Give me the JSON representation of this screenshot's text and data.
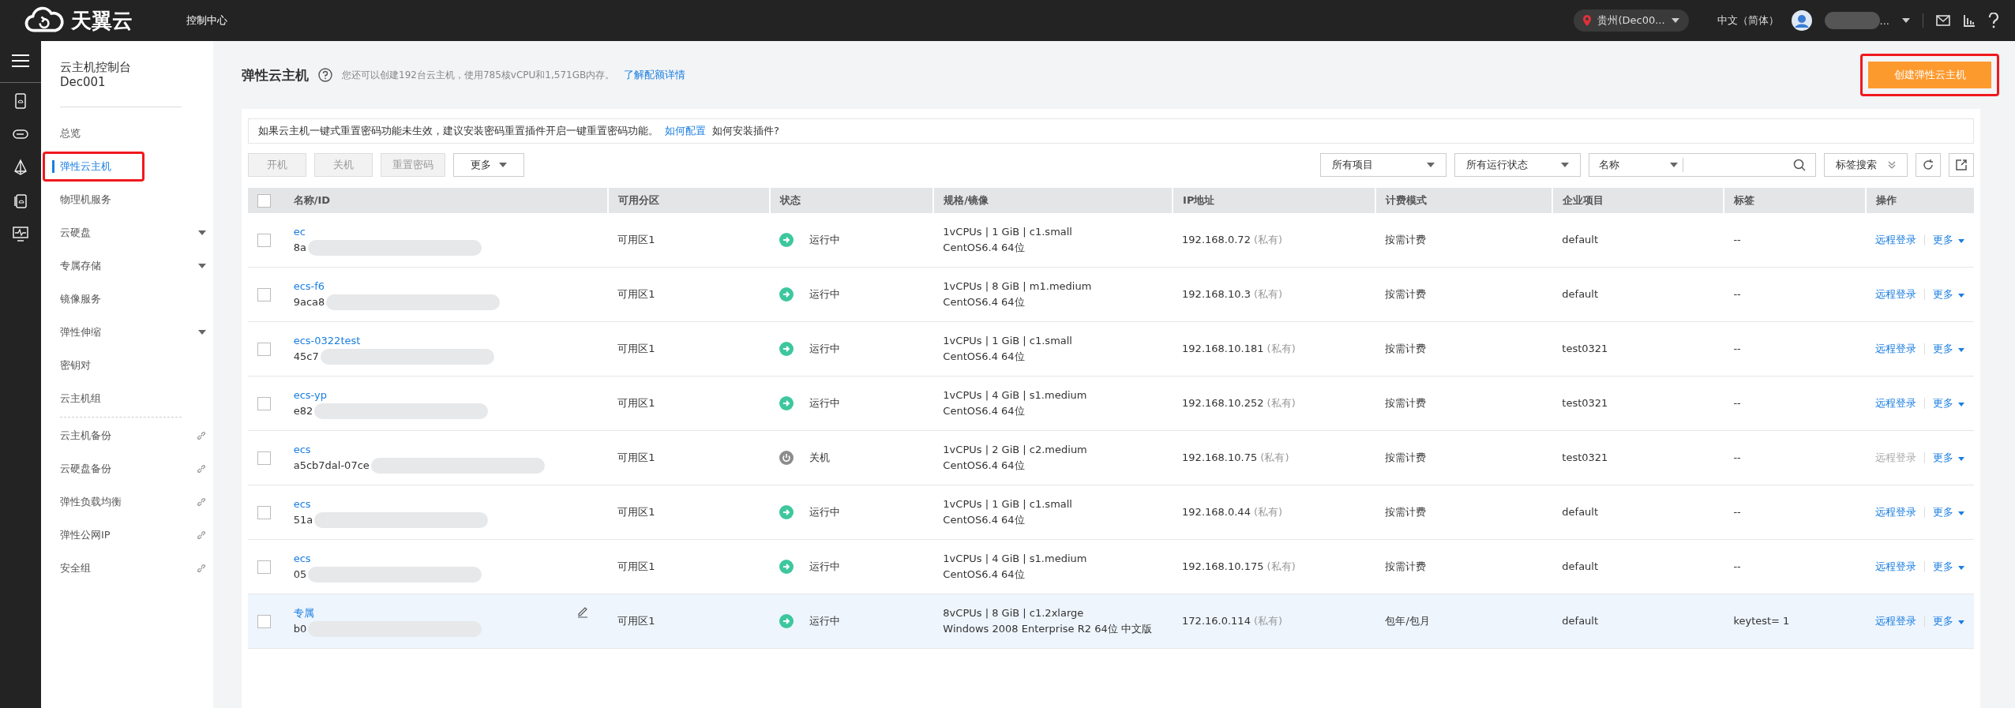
{
  "top_bar": {
    "brand": "天翼云",
    "console": "控制中心",
    "region": "贵州(Dec00...",
    "language": "中文（简体）",
    "user_name": "..."
  },
  "sidebar": {
    "title": "云主机控制台",
    "subtitle": "Dec001",
    "groups": [
      [
        {
          "label": "总览",
          "selected": false,
          "annotated": false,
          "kind": "plain"
        },
        {
          "label": "弹性云主机",
          "selected": true,
          "annotated": true,
          "kind": "plain"
        },
        {
          "label": "物理机服务",
          "selected": false,
          "annotated": false,
          "kind": "plain"
        },
        {
          "label": "云硬盘",
          "selected": false,
          "annotated": false,
          "kind": "menu"
        },
        {
          "label": "专属存储",
          "selected": false,
          "annotated": false,
          "kind": "menu"
        },
        {
          "label": "镜像服务",
          "selected": false,
          "annotated": false,
          "kind": "plain"
        },
        {
          "label": "弹性伸缩",
          "selected": false,
          "annotated": false,
          "kind": "menu"
        },
        {
          "label": "密钥对",
          "selected": false,
          "annotated": false,
          "kind": "plain"
        },
        {
          "label": "云主机组",
          "selected": false,
          "annotated": false,
          "kind": "plain"
        }
      ],
      [
        {
          "label": "云主机备份",
          "selected": false,
          "annotated": false,
          "kind": "link"
        },
        {
          "label": "云硬盘备份",
          "selected": false,
          "annotated": false,
          "kind": "link"
        },
        {
          "label": "弹性负载均衡",
          "selected": false,
          "annotated": false,
          "kind": "link"
        },
        {
          "label": "弹性公网IP",
          "selected": false,
          "annotated": false,
          "kind": "link"
        },
        {
          "label": "安全组",
          "selected": false,
          "annotated": false,
          "kind": "link"
        }
      ]
    ]
  },
  "header": {
    "title": "弹性云主机",
    "quota_text": "您还可以创建192台云主机，使用785核vCPU和1,571GB内存。",
    "quota_link": "了解配额详情",
    "create_button": {
      "label": "创建弹性云主机",
      "annotated": true
    }
  },
  "notice": {
    "text": "如果云主机一键式重置密码功能未生效，建议安装密码重置插件开启一键重置密码功能。",
    "link": "如何配置",
    "question": "如何安装插件?"
  },
  "toolbar": {
    "buttons": [
      {
        "label": "开机",
        "disabled": true
      },
      {
        "label": "关机",
        "disabled": true
      },
      {
        "label": "重置密码",
        "disabled": true
      }
    ],
    "more": "更多",
    "filters": [
      "所有项目",
      "所有运行状态"
    ],
    "search_field": "名称",
    "tag_search": "标签搜索"
  },
  "table": {
    "all_checked": false,
    "columns": [
      "名称/ID",
      "可用分区",
      "状态",
      "规格/镜像",
      "IP地址",
      "计费模式",
      "企业项目",
      "标签",
      "操作"
    ],
    "rows": [
      {
        "name": "ec",
        "id": "8a",
        "zone": "可用区1",
        "status": {
          "kind": "running",
          "label": "运行中"
        },
        "spec": "1vCPUs | 1 GiB | c1.small",
        "image": "CentOS6.4 64位",
        "ip": "192.168.0.72",
        "ip_type": "(私有)",
        "billing": "按需计费",
        "project": "default",
        "tag": "--",
        "login": "远程登录",
        "login_disabled": false,
        "more": "更多",
        "highlighted": false,
        "editable": false,
        "checked": false
      },
      {
        "name": "ecs-f6",
        "id": "9aca8",
        "zone": "可用区1",
        "status": {
          "kind": "running",
          "label": "运行中"
        },
        "spec": "1vCPUs | 8 GiB | m1.medium",
        "image": "CentOS6.4 64位",
        "ip": "192.168.10.3",
        "ip_type": "(私有)",
        "billing": "按需计费",
        "project": "default",
        "tag": "--",
        "login": "远程登录",
        "login_disabled": false,
        "more": "更多",
        "highlighted": false,
        "editable": false,
        "checked": false
      },
      {
        "name": "ecs-0322test",
        "id": "45c7",
        "zone": "可用区1",
        "status": {
          "kind": "running",
          "label": "运行中"
        },
        "spec": "1vCPUs | 1 GiB | c1.small",
        "image": "CentOS6.4 64位",
        "ip": "192.168.10.181",
        "ip_type": "(私有)",
        "billing": "按需计费",
        "project": "test0321",
        "tag": "--",
        "login": "远程登录",
        "login_disabled": false,
        "more": "更多",
        "highlighted": false,
        "editable": false,
        "checked": false
      },
      {
        "name": "ecs-yp",
        "id": "e82",
        "zone": "可用区1",
        "status": {
          "kind": "running",
          "label": "运行中"
        },
        "spec": "1vCPUs | 4 GiB | s1.medium",
        "image": "CentOS6.4 64位",
        "ip": "192.168.10.252",
        "ip_type": "(私有)",
        "billing": "按需计费",
        "project": "test0321",
        "tag": "--",
        "login": "远程登录",
        "login_disabled": false,
        "more": "更多",
        "highlighted": false,
        "editable": false,
        "checked": false
      },
      {
        "name": "ecs",
        "id": "a5cb7dal-07ce",
        "zone": "可用区1",
        "status": {
          "kind": "stopped",
          "label": "关机"
        },
        "spec": "1vCPUs | 2 GiB | c2.medium",
        "image": "CentOS6.4 64位",
        "ip": "192.168.10.75",
        "ip_type": "(私有)",
        "billing": "按需计费",
        "project": "test0321",
        "tag": "--",
        "login": "远程登录",
        "login_disabled": true,
        "more": "更多",
        "highlighted": false,
        "editable": false,
        "checked": false
      },
      {
        "name": "ecs",
        "id": "51a",
        "zone": "可用区1",
        "status": {
          "kind": "running",
          "label": "运行中"
        },
        "spec": "1vCPUs | 1 GiB | c1.small",
        "image": "CentOS6.4 64位",
        "ip": "192.168.0.44",
        "ip_type": "(私有)",
        "billing": "按需计费",
        "project": "default",
        "tag": "--",
        "login": "远程登录",
        "login_disabled": false,
        "more": "更多",
        "highlighted": false,
        "editable": false,
        "checked": false
      },
      {
        "name": "ecs",
        "id": "05",
        "zone": "可用区1",
        "status": {
          "kind": "running",
          "label": "运行中"
        },
        "spec": "1vCPUs | 4 GiB | s1.medium",
        "image": "CentOS6.4 64位",
        "ip": "192.168.10.175",
        "ip_type": "(私有)",
        "billing": "按需计费",
        "project": "default",
        "tag": "--",
        "login": "远程登录",
        "login_disabled": false,
        "more": "更多",
        "highlighted": false,
        "editable": false,
        "checked": false
      },
      {
        "name": "专属",
        "id": "b0",
        "zone": "可用区1",
        "status": {
          "kind": "running",
          "label": "运行中"
        },
        "spec": "8vCPUs | 8 GiB | c1.2xlarge",
        "image": "Windows 2008 Enterprise R2 64位 中文版",
        "ip": "172.16.0.114",
        "ip_type": "(私有)",
        "billing": "包年/包月",
        "project": "default",
        "tag": "keytest= 1",
        "login": "远程登录",
        "login_disabled": false,
        "more": "更多",
        "highlighted": true,
        "editable": true,
        "checked": false
      }
    ]
  }
}
